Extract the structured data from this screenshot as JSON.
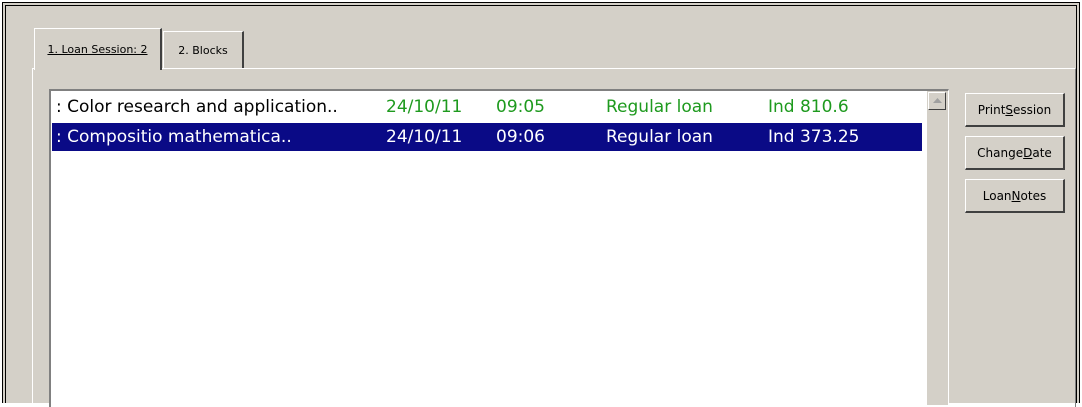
{
  "tabs": [
    {
      "label": "1. Loan Session: 2",
      "active": true
    },
    {
      "label": "2. Blocks",
      "active": false
    }
  ],
  "loans": [
    {
      "title": ": Color research and application..",
      "date": "24/10/11",
      "time": "09:05",
      "loan_type": "Regular loan",
      "shelfmark": "Ind 810.6",
      "selected": false
    },
    {
      "title": ": Compositio mathematica..",
      "date": "24/10/11",
      "time": "09:06",
      "loan_type": "Regular loan",
      "shelfmark": "Ind 373.25",
      "selected": true
    }
  ],
  "buttons": {
    "print_session": {
      "pre": "Print ",
      "key": "S",
      "post": "ession"
    },
    "change_date": {
      "pre": "Change ",
      "key": "D",
      "post": "ate"
    },
    "loan_notes": {
      "pre": "Loan ",
      "key": "N",
      "post": "otes"
    }
  },
  "colors": {
    "accent_green": "#1e9a1e",
    "selection_blue": "#0a0a86",
    "chrome_gray": "#d4d0c8"
  },
  "icons": {
    "scroll_up": "scroll-up-arrow-icon"
  }
}
